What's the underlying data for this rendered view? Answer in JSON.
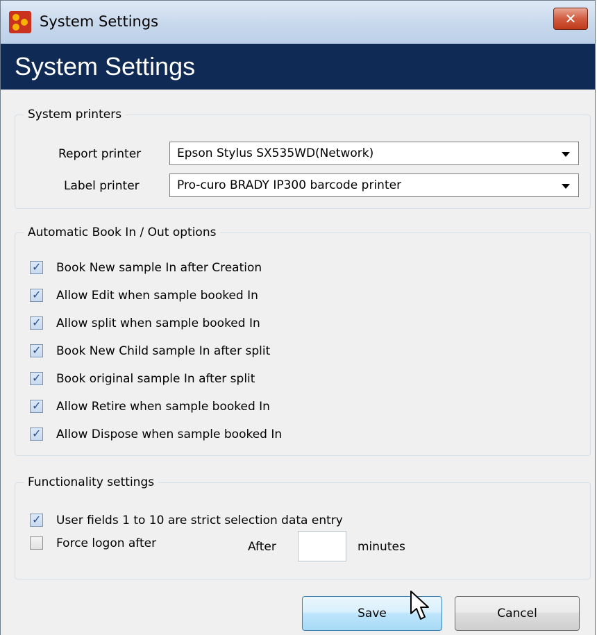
{
  "window": {
    "title": "System Settings",
    "close_glyph": "✕"
  },
  "banner": {
    "title": "System Settings"
  },
  "printers": {
    "group_title": "System printers",
    "report_label": "Report printer",
    "report_value": "Epson Stylus SX535WD(Network)",
    "label_label": "Label printer",
    "label_value": "Pro-curo BRADY IP300 barcode printer"
  },
  "book_options": {
    "group_title": "Automatic Book In / Out options",
    "items": [
      {
        "label": "Book New sample In after Creation",
        "checked": true
      },
      {
        "label": "Allow Edit when sample booked In",
        "checked": true
      },
      {
        "label": "Allow split when sample booked In",
        "checked": true
      },
      {
        "label": "Book New Child sample In after split",
        "checked": true
      },
      {
        "label": "Book original sample In after split",
        "checked": true
      },
      {
        "label": "Allow Retire when sample booked In",
        "checked": true
      },
      {
        "label": "Allow Dispose when sample booked In",
        "checked": true
      }
    ]
  },
  "functionality": {
    "group_title": "Functionality settings",
    "strict_label": "User fields 1 to 10 are strict selection data entry",
    "strict_checked": true,
    "force_logon_label": "Force logon after",
    "force_logon_checked": false,
    "after_label": "After",
    "minutes_value": "",
    "minutes_label": "minutes"
  },
  "buttons": {
    "save": "Save",
    "cancel": "Cancel"
  },
  "icons": {
    "checkbox_tick": "✓"
  },
  "colors": {
    "banner": "#0f2b55",
    "close": "#c0391b",
    "accent": "#3c7fb1"
  }
}
